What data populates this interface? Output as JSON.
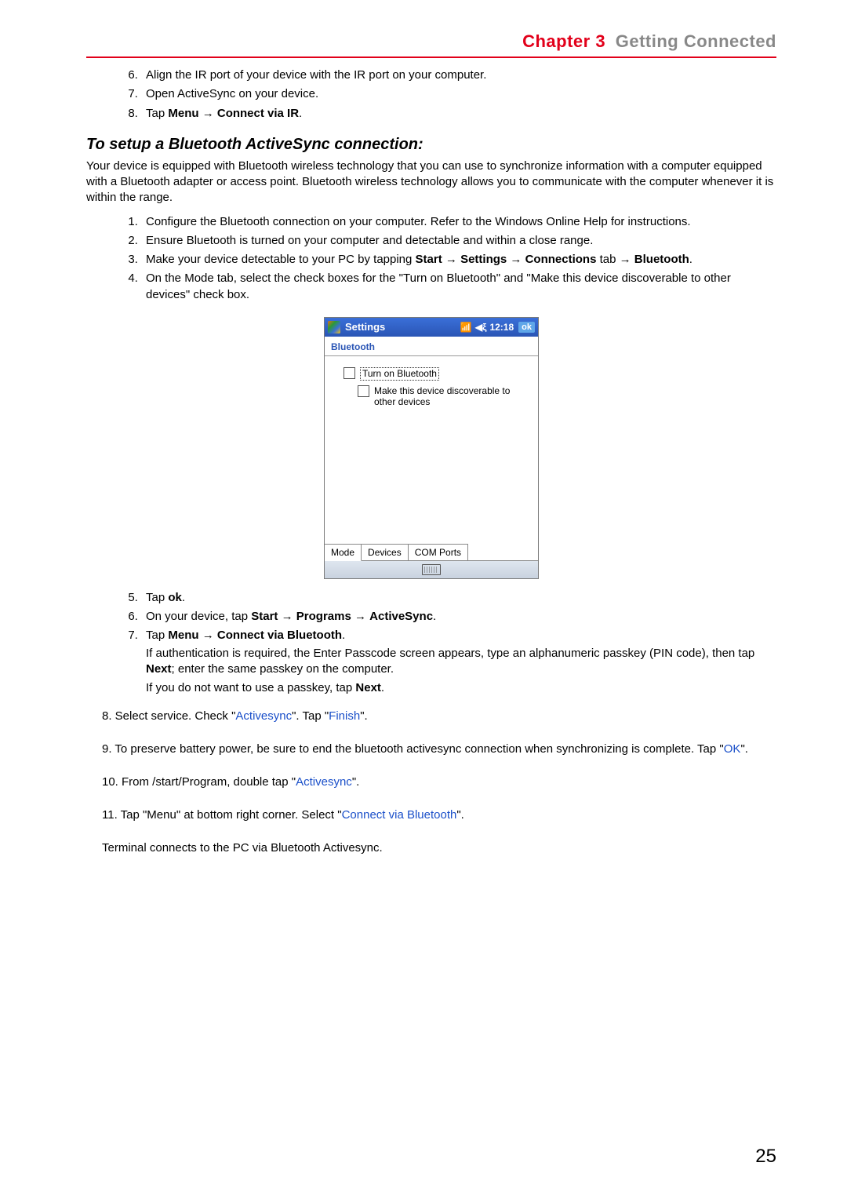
{
  "header": {
    "chapter": "Chapter 3",
    "title": "Getting Connected"
  },
  "top_list": {
    "start": 6,
    "items": [
      "Align the IR port of your device with the IR port on your computer.",
      "Open ActiveSync on your device.",
      {
        "prefix": "Tap ",
        "bold": "Menu → Connect via IR",
        "suffix": "."
      }
    ]
  },
  "section_heading": "To setup a Bluetooth ActiveSync connection:",
  "intro": "Your device is equipped with Bluetooth wireless technology that you can use to synchronize information with a computer equipped with a Bluetooth adapter or access point. Bluetooth wireless technology allows you to communicate with the computer whenever it is within the range.",
  "mid_list": {
    "start": 1,
    "items": [
      "Configure the Bluetooth connection on your computer. Refer to the Windows Online Help for instructions.",
      "Ensure Bluetooth is turned on your computer and detectable and within a close range.",
      {
        "segments": [
          {
            "t": "Make your device detectable to your PC by tapping "
          },
          {
            "t": "Start",
            "b": true
          },
          {
            "t": " → "
          },
          {
            "t": "Settings",
            "b": true
          },
          {
            "t": " → "
          },
          {
            "t": "Connections",
            "b": true
          },
          {
            "t": " tab → "
          },
          {
            "t": "Bluetooth",
            "b": true
          },
          {
            "t": "."
          }
        ]
      },
      "On the Mode tab, select the check boxes for the \"Turn on Bluetooth\" and \"Make this device discoverable to other devices\" check box."
    ]
  },
  "device": {
    "title": "Settings",
    "time": "12:18",
    "ok": "ok",
    "subtitle": "Bluetooth",
    "checkbox1": "Turn on Bluetooth",
    "checkbox2": "Make this device discoverable to other devices",
    "tabs": [
      "Mode",
      "Devices",
      "COM Ports"
    ]
  },
  "after_list": {
    "start": 5,
    "items": [
      {
        "segments": [
          {
            "t": "Tap "
          },
          {
            "t": "ok",
            "b": true
          },
          {
            "t": "."
          }
        ]
      },
      {
        "segments": [
          {
            "t": "On your device, tap "
          },
          {
            "t": "Start",
            "b": true
          },
          {
            "t": " → "
          },
          {
            "t": "Programs",
            "b": true
          },
          {
            "t": " → "
          },
          {
            "t": "ActiveSync",
            "b": true
          },
          {
            "t": "."
          }
        ]
      },
      {
        "segments": [
          {
            "t": "Tap "
          },
          {
            "t": "Menu → Connect via Bluetooth",
            "b": true
          },
          {
            "t": "."
          }
        ],
        "notes": [
          {
            "segments": [
              {
                "t": "If authentication is required, the Enter Passcode screen appears, type an alphanumeric passkey (PIN code), then tap "
              },
              {
                "t": "Next",
                "b": true
              },
              {
                "t": "; enter the same passkey on the computer."
              }
            ]
          },
          {
            "segments": [
              {
                "t": "If you do not want to use a passkey, tap "
              },
              {
                "t": "Next",
                "b": true
              },
              {
                "t": "."
              }
            ]
          }
        ]
      }
    ]
  },
  "freesteps": [
    {
      "segments": [
        {
          "t": "8. Select service. Check \""
        },
        {
          "t": "Activesync",
          "c": "blue"
        },
        {
          "t": "\". Tap \""
        },
        {
          "t": "Finish",
          "c": "blue"
        },
        {
          "t": "\"."
        }
      ]
    },
    {
      "segments": [
        {
          "t": "9. To preserve battery power, be sure to end the bluetooth activesync connection when synchronizing is complete. Tap \""
        },
        {
          "t": "OK",
          "c": "blue"
        },
        {
          "t": "\"."
        }
      ]
    },
    {
      "segments": [
        {
          "t": "10. From /start/Program, double tap \""
        },
        {
          "t": "Activesync",
          "c": "blue"
        },
        {
          "t": "\"."
        }
      ]
    },
    {
      "segments": [
        {
          "t": "11. Tap \"Menu\" at bottom right corner. Select \""
        },
        {
          "t": "Connect via Bluetooth",
          "c": "blue"
        },
        {
          "t": "\"."
        }
      ]
    },
    {
      "segments": [
        {
          "t": "Terminal connects to the PC via Bluetooth Activesync."
        }
      ]
    }
  ],
  "page_number": "25"
}
